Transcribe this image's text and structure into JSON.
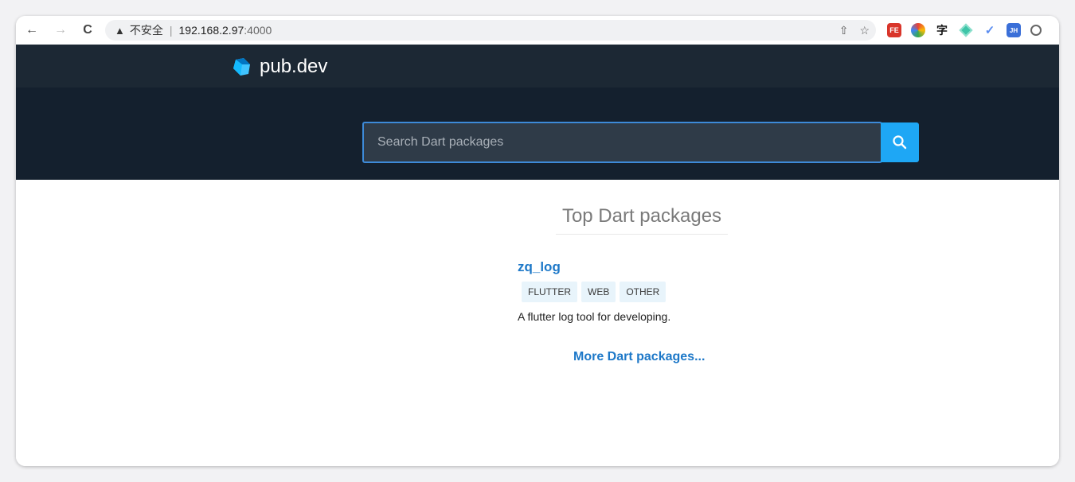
{
  "browser": {
    "back_icon": "←",
    "forward_icon": "→",
    "reload_icon": "C",
    "warning_icon": "▲",
    "insecure_label": "不安全",
    "separator": "|",
    "host": "192.168.2.97",
    "port": ":4000",
    "share_icon": "⇧",
    "bookmark_icon": "☆",
    "extensions": [
      {
        "name": "fe-helper",
        "label": "FE"
      },
      {
        "name": "color-picker",
        "label": ""
      },
      {
        "name": "zi",
        "label": "字"
      },
      {
        "name": "diamond",
        "label": ""
      },
      {
        "name": "check",
        "label": "✓"
      },
      {
        "name": "jh",
        "label": "JH"
      },
      {
        "name": "extension",
        "label": ""
      }
    ]
  },
  "site": {
    "logo_text": "pub.dev",
    "search_placeholder": "Search Dart packages",
    "accent": "#1ea7f5"
  },
  "main": {
    "section_title": "Top Dart packages",
    "packages": [
      {
        "name": "zq_log",
        "tags": [
          "FLUTTER",
          "WEB",
          "OTHER"
        ],
        "description": "A flutter log tool for developing."
      }
    ],
    "more_link": "More Dart packages..."
  }
}
